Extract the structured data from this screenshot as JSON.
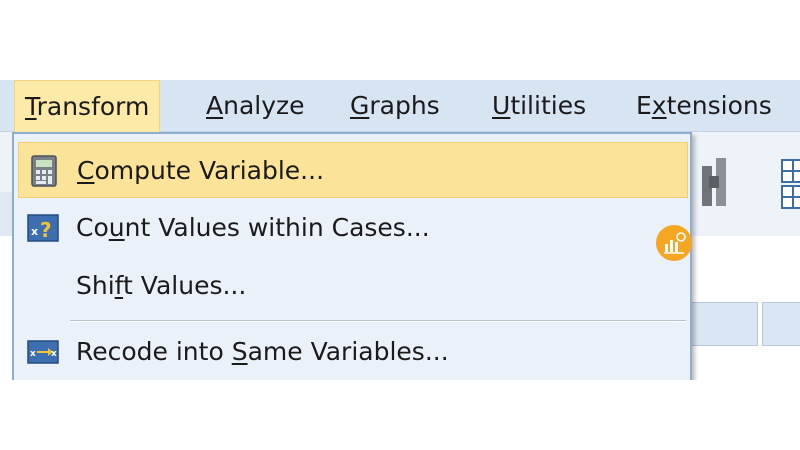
{
  "menubar": {
    "items": [
      {
        "pre": "",
        "key": "T",
        "post": "ransform",
        "active": true
      },
      {
        "pre": "",
        "key": "A",
        "post": "nalyze",
        "active": false
      },
      {
        "pre": "",
        "key": "G",
        "post": "raphs",
        "active": false
      },
      {
        "pre": "",
        "key": "U",
        "post": "tilities",
        "active": false
      },
      {
        "pre": "E",
        "key": "x",
        "post": "tensions",
        "active": false
      }
    ]
  },
  "transform_menu": {
    "items": [
      {
        "pre": "",
        "key": "C",
        "post": "ompute Variable...",
        "icon": "calculator-icon",
        "highlighted": true
      },
      {
        "pre": "Co",
        "key": "u",
        "post": "nt Values within Cases...",
        "icon": "count-values-icon",
        "highlighted": false
      },
      {
        "pre": "Shi",
        "key": "f",
        "post": "t Values...",
        "icon": "",
        "highlighted": false
      },
      {
        "pre": "Recode into ",
        "key": "S",
        "post": "ame Variables...",
        "icon": "recode-icon",
        "highlighted": false
      }
    ]
  },
  "colors": {
    "menubar_bg": "#d7e4f2",
    "dropdown_bg": "#eaf1f9",
    "highlight": "#fbe49a",
    "badge": "#f5a623"
  },
  "overlay": {
    "icon": "chart-badge-icon"
  }
}
